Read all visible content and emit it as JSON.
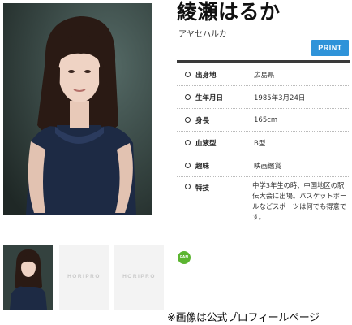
{
  "header": {
    "name": "綾瀬はるか",
    "name_kana": "アヤセハルカ",
    "print_label": "PRINT"
  },
  "profile": {
    "rows": [
      {
        "key": "出身地",
        "value": "広島県"
      },
      {
        "key": "生年月日",
        "value": "1985年3月24日"
      },
      {
        "key": "身長",
        "value": "165cm"
      },
      {
        "key": "血液型",
        "value": "B型"
      },
      {
        "key": "趣味",
        "value": "映画鑑賞"
      },
      {
        "key": "特技",
        "value": "中学3年生の時、中国地区の駅伝大会に出場。バスケットボールなどスポーツは何でも得意です。"
      }
    ]
  },
  "thumbnails": [
    {
      "kind": "photo"
    },
    {
      "kind": "placeholder",
      "logo": "HORIPRO"
    },
    {
      "kind": "placeholder",
      "logo": "HORIPRO"
    }
  ],
  "fan_badge": "FAN",
  "caption": "※画像は公式プロフィールページ",
  "colors": {
    "print_button": "#2f93d9",
    "fan_badge": "#5cb531",
    "table_top_border": "#3a3a3a"
  }
}
